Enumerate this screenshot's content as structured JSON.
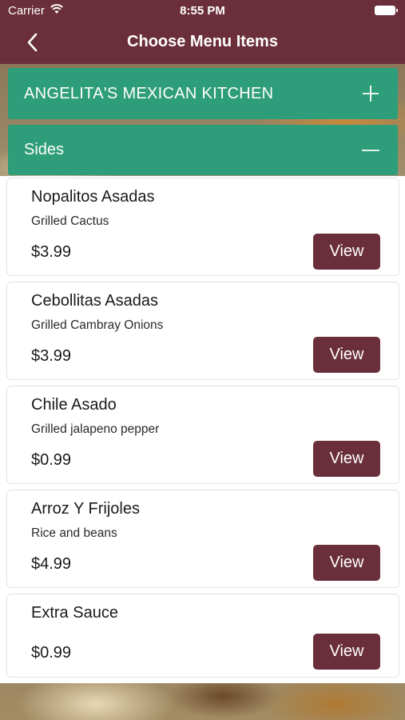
{
  "status_bar": {
    "carrier": "Carrier",
    "time": "8:55 PM"
  },
  "nav": {
    "title": "Choose Menu Items",
    "back_icon": "chevron-left-icon"
  },
  "sections": {
    "restaurant": {
      "label": "ANGELITA'S MEXICAN KITCHEN",
      "toggle_icon": "plus-icon"
    },
    "sides": {
      "label": "Sides",
      "toggle_icon": "minus-icon"
    }
  },
  "items": [
    {
      "name": "Nopalitos Asadas",
      "description": "Grilled Cactus",
      "price": "$3.99",
      "button": "View"
    },
    {
      "name": "Cebollitas Asadas",
      "description": "Grilled Cambray Onions",
      "price": "$3.99",
      "button": "View"
    },
    {
      "name": "Chile Asado",
      "description": "Grilled jalapeno pepper",
      "price": "$0.99",
      "button": "View"
    },
    {
      "name": "Arroz Y Frijoles",
      "description": "Rice and beans",
      "price": "$4.99",
      "button": "View"
    },
    {
      "name": "Extra Sauce",
      "description": "",
      "price": "$0.99",
      "button": "View"
    }
  ],
  "colors": {
    "nav_bar": "#6b2f3b",
    "section_header": "#2e9d79",
    "view_button": "#6b2f3b"
  }
}
